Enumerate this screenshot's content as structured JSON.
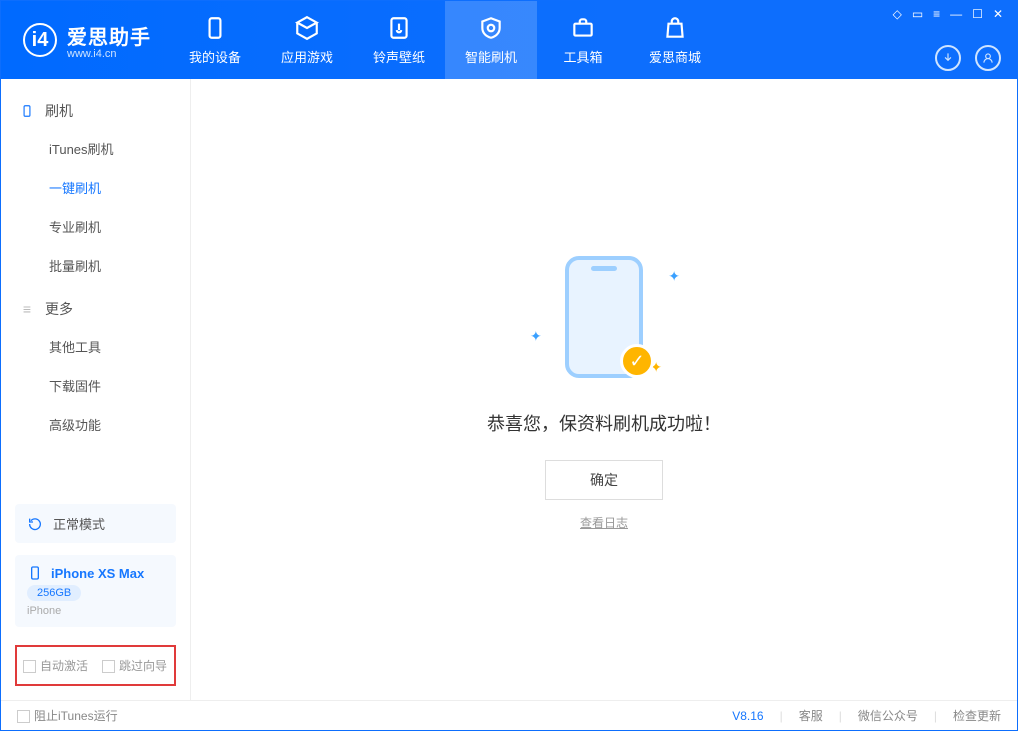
{
  "app": {
    "title": "爱思助手",
    "subtitle": "www.i4.cn"
  },
  "tabs": [
    {
      "label": "我的设备"
    },
    {
      "label": "应用游戏"
    },
    {
      "label": "铃声壁纸"
    },
    {
      "label": "智能刷机"
    },
    {
      "label": "工具箱"
    },
    {
      "label": "爱思商城"
    }
  ],
  "sidebar": {
    "section1": {
      "title": "刷机"
    },
    "items1": [
      {
        "label": "iTunes刷机"
      },
      {
        "label": "一键刷机"
      },
      {
        "label": "专业刷机"
      },
      {
        "label": "批量刷机"
      }
    ],
    "section2": {
      "title": "更多"
    },
    "items2": [
      {
        "label": "其他工具"
      },
      {
        "label": "下载固件"
      },
      {
        "label": "高级功能"
      }
    ]
  },
  "mode": {
    "label": "正常模式"
  },
  "device": {
    "name": "iPhone XS Max",
    "capacity": "256GB",
    "type": "iPhone"
  },
  "options": {
    "auto_activate": "自动激活",
    "skip_guide": "跳过向导"
  },
  "main": {
    "success_text": "恭喜您，保资料刷机成功啦！",
    "ok_label": "确定",
    "log_link": "查看日志"
  },
  "footer": {
    "block_itunes": "阻止iTunes运行",
    "version": "V8.16",
    "service": "客服",
    "wechat": "微信公众号",
    "update": "检查更新"
  }
}
